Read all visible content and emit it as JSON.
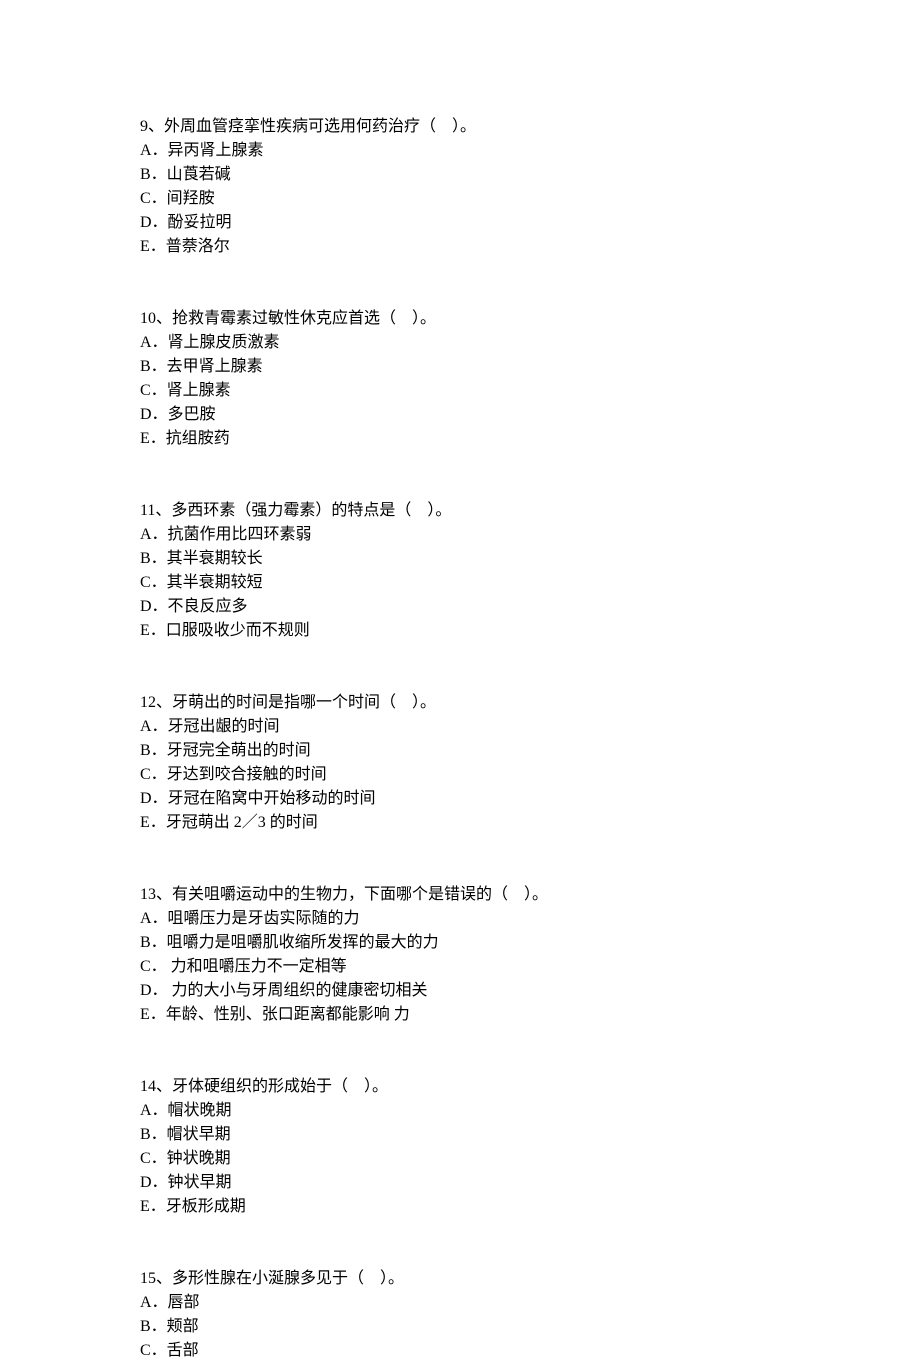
{
  "questions": [
    {
      "q": "9、外周血管痉挛性疾病可选用何药治疗（　）。",
      "options": [
        "A．异丙肾上腺素",
        "B．山莨若碱",
        "C．间羟胺",
        "D．酚妥拉明",
        "E．普萘洛尔"
      ]
    },
    {
      "q": "10、抢救青霉素过敏性休克应首选（　）。",
      "options": [
        "A．肾上腺皮质激素",
        "B．去甲肾上腺素",
        "C．肾上腺素",
        "D．多巴胺",
        "E．抗组胺药"
      ]
    },
    {
      "q": "11、多西环素（强力霉素）的特点是（　）。",
      "options": [
        "A．抗菌作用比四环素弱",
        "B．其半衰期较长",
        "C．其半衰期较短",
        "D．不良反应多",
        "E．口服吸收少而不规则"
      ]
    },
    {
      "q": "12、牙萌出的时间是指哪一个时间（　）。",
      "options": [
        "A．牙冠出龈的时间",
        "B．牙冠完全萌出的时间",
        "C．牙达到咬合接触的时间",
        "D．牙冠在陷窝中开始移动的时间",
        "E．牙冠萌出 2／3 的时间"
      ]
    },
    {
      "q": "13、有关咀嚼运动中的生物力，下面哪个是错误的（　）。",
      "options": [
        "A．咀嚼压力是牙齿实际随的力",
        "B．咀嚼力是咀嚼肌收缩所发挥的最大的力",
        "C．  力和咀嚼压力不一定相等",
        "D．  力的大小与牙周组织的健康密切相关",
        "E．年龄、性别、张口距离都能影响  力"
      ]
    },
    {
      "q": "14、牙体硬组织的形成始于（　）。",
      "options": [
        "A．帽状晚期",
        "B．帽状早期",
        "C．钟状晚期",
        "D．钟状早期",
        "E．牙板形成期"
      ]
    },
    {
      "q": "15、多形性腺在小涎腺多见于（　）。",
      "options": [
        "A．唇部",
        "B．颊部",
        "C．舌部"
      ]
    }
  ]
}
